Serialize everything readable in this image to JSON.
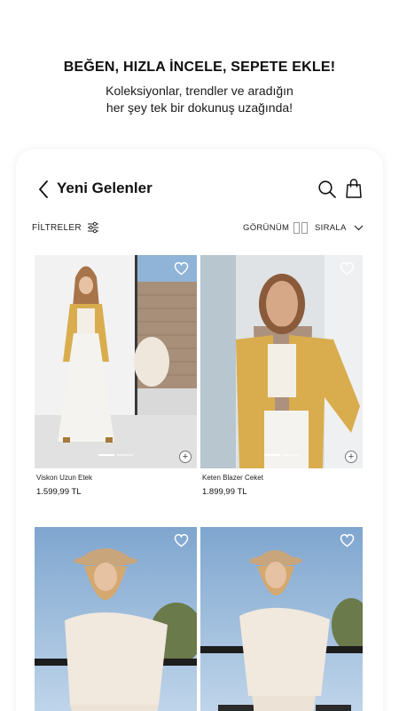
{
  "promo": {
    "title": "BEĞEN, HIZLA İNCELE, SEPETE EKLE!",
    "subtitle_line1": "Koleksiyonlar, trendler ve aradığın",
    "subtitle_line2": "her şey tek bir dokunuş uzağında!"
  },
  "header": {
    "title": "Yeni Gelenler",
    "back_icon": "chevron-left-icon",
    "search_icon": "search-icon",
    "bag_icon": "shopping-bag-icon"
  },
  "filterbar": {
    "filters_label": "FİLTRELER",
    "view_label": "GÖRÜNÜM",
    "sort_label": "SIRALA"
  },
  "products": [
    {
      "name": "Viskon Uzun Etek",
      "price": "1.599,99 TL"
    },
    {
      "name": "Keten Blazer Ceket",
      "price": "1.899,99 TL"
    },
    {
      "name": "",
      "price": ""
    },
    {
      "name": "",
      "price": ""
    }
  ],
  "colors": {
    "text": "#111111",
    "card_bg": "#ffffff",
    "blazer": "#d9ad4e",
    "sky": "#8fb4d8"
  }
}
